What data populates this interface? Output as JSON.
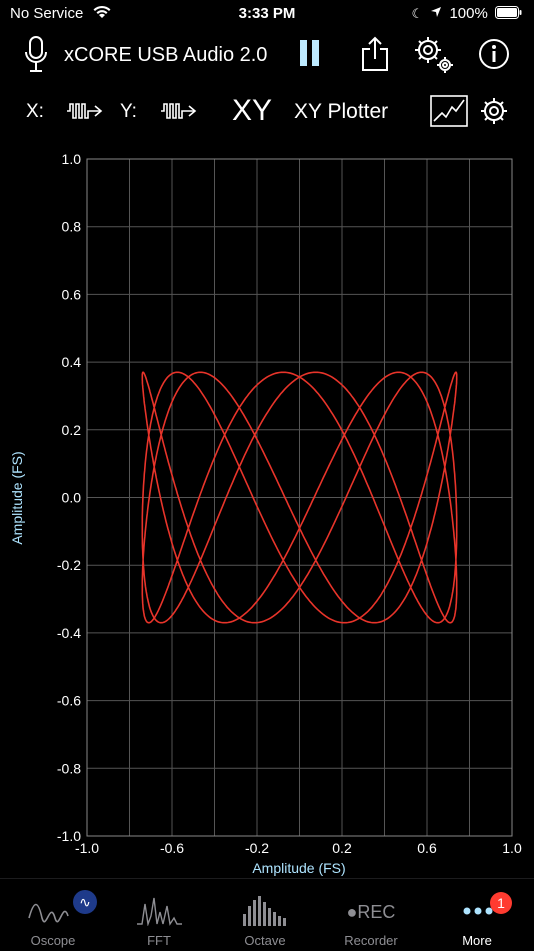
{
  "status": {
    "carrier": "No Service",
    "time": "3:33 PM",
    "battery": "100%"
  },
  "header": {
    "device_name": "xCORE USB Audio 2.0"
  },
  "controls": {
    "x_label": "X:",
    "y_label": "Y:",
    "mode": "XY",
    "plot_name": "XY Plotter"
  },
  "plot": {
    "x_ticks": [
      "-1.0",
      "-0.6",
      "-0.2",
      "0.2",
      "0.6",
      "1.0"
    ],
    "y_ticks": [
      "1.0",
      "0.8",
      "0.6",
      "0.4",
      "0.2",
      "0.0",
      "-0.2",
      "-0.4",
      "-0.6",
      "-0.8",
      "-1.0"
    ],
    "x_axis_label": "Amplitude (FS)",
    "y_axis_label": "Amplitude (FS)",
    "trace_color": "#e8342a",
    "grid_color": "#555555"
  },
  "chart_data": {
    "type": "line",
    "title": "",
    "xlabel": "Amplitude (FS)",
    "ylabel": "Amplitude (FS)",
    "xlim": [
      -1.0,
      1.0
    ],
    "ylim": [
      -1.0,
      1.0
    ],
    "series": [
      {
        "curve": "lissajous",
        "x_amplitude": 0.74,
        "y_amplitude": 0.37,
        "x_freq": 3,
        "y_freq": 8,
        "phase": 0.3
      }
    ]
  },
  "tabs": [
    {
      "label": "Oscope",
      "icon": "sine-wave-icon"
    },
    {
      "label": "FFT",
      "icon": "fft-icon"
    },
    {
      "label": "Octave",
      "icon": "octave-bars-icon"
    },
    {
      "label": "Recorder",
      "icon": "rec-icon",
      "icon_text": "●REC"
    },
    {
      "label": "More",
      "icon": "more-dots-icon",
      "badge": "1"
    }
  ]
}
